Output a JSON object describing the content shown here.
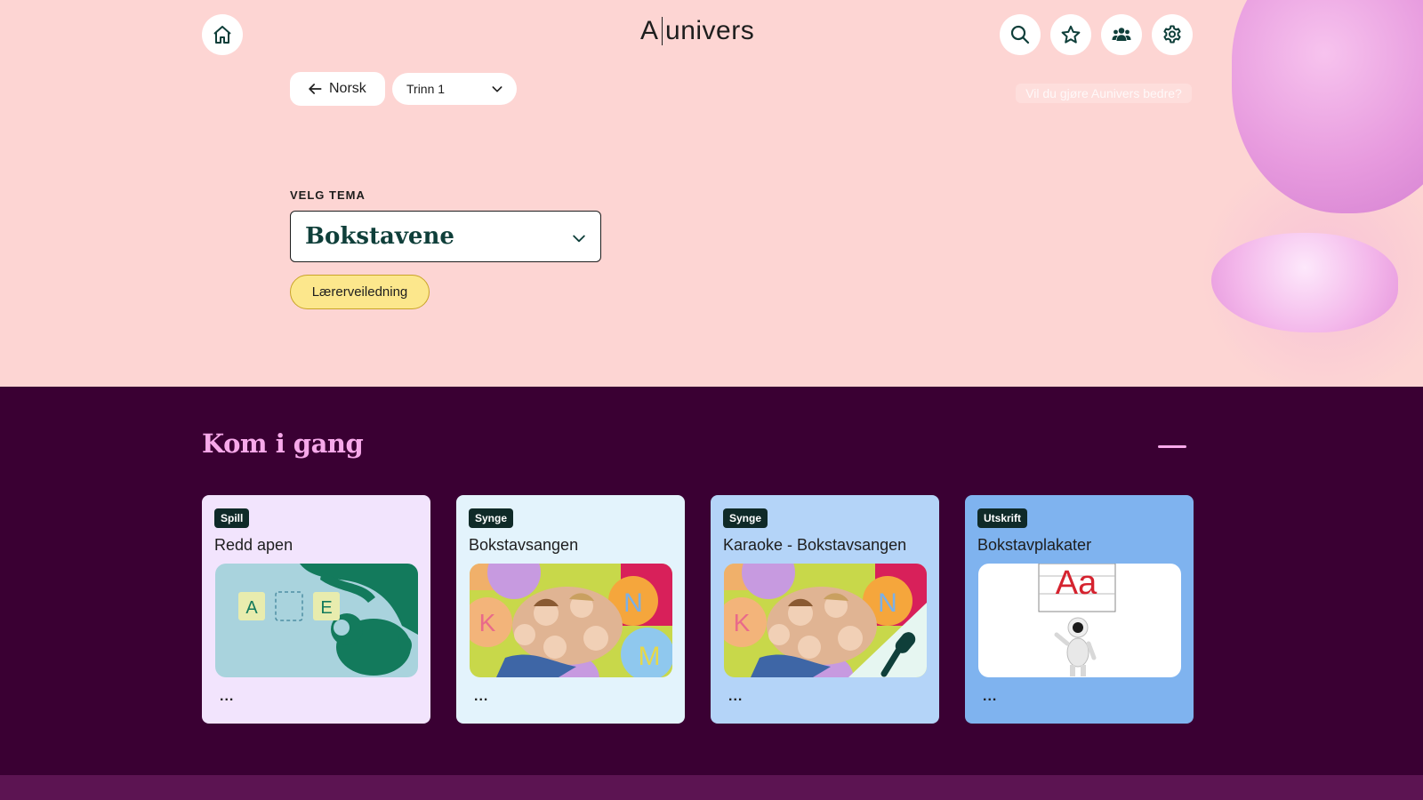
{
  "header": {
    "logo_left": "A",
    "logo_right": "univers",
    "icons": [
      "home-icon",
      "search-icon",
      "star-icon",
      "users-icon",
      "gear-icon"
    ]
  },
  "nav": {
    "back_label": "Norsk",
    "grade_selected": "Trinn 1",
    "feedback_text": "Vil du gjøre Aunivers bedre?"
  },
  "theme": {
    "label": "VELG TEMA",
    "selected": "Bokstavene",
    "teacher_guide_label": "Lærerveiledning"
  },
  "section": {
    "title": "Kom i gang",
    "cards": [
      {
        "tag": "Spill",
        "title": "Redd apen",
        "more": "...",
        "bg": "#f2e4fd"
      },
      {
        "tag": "Synge",
        "title": "Bokstavsangen",
        "more": "...",
        "bg": "#e3f3fc"
      },
      {
        "tag": "Synge",
        "title": "Karaoke - Bokstavsangen",
        "more": "...",
        "bg": "#b4d4f8"
      },
      {
        "tag": "Utskrift",
        "title": "Bokstavplakater",
        "more": "...",
        "bg": "#7fb3ef"
      }
    ],
    "thumb_letters": {
      "game": [
        "A",
        "E"
      ],
      "song": [
        "K",
        "N",
        "M"
      ],
      "poster": "Aa"
    }
  },
  "colors": {
    "hero_bg": "#fdd5d3",
    "dark_bg": "#3a0033",
    "accent_pink": "#f7a9ea",
    "teal_dark": "#0f3f3a",
    "yellow": "#fce78c"
  }
}
